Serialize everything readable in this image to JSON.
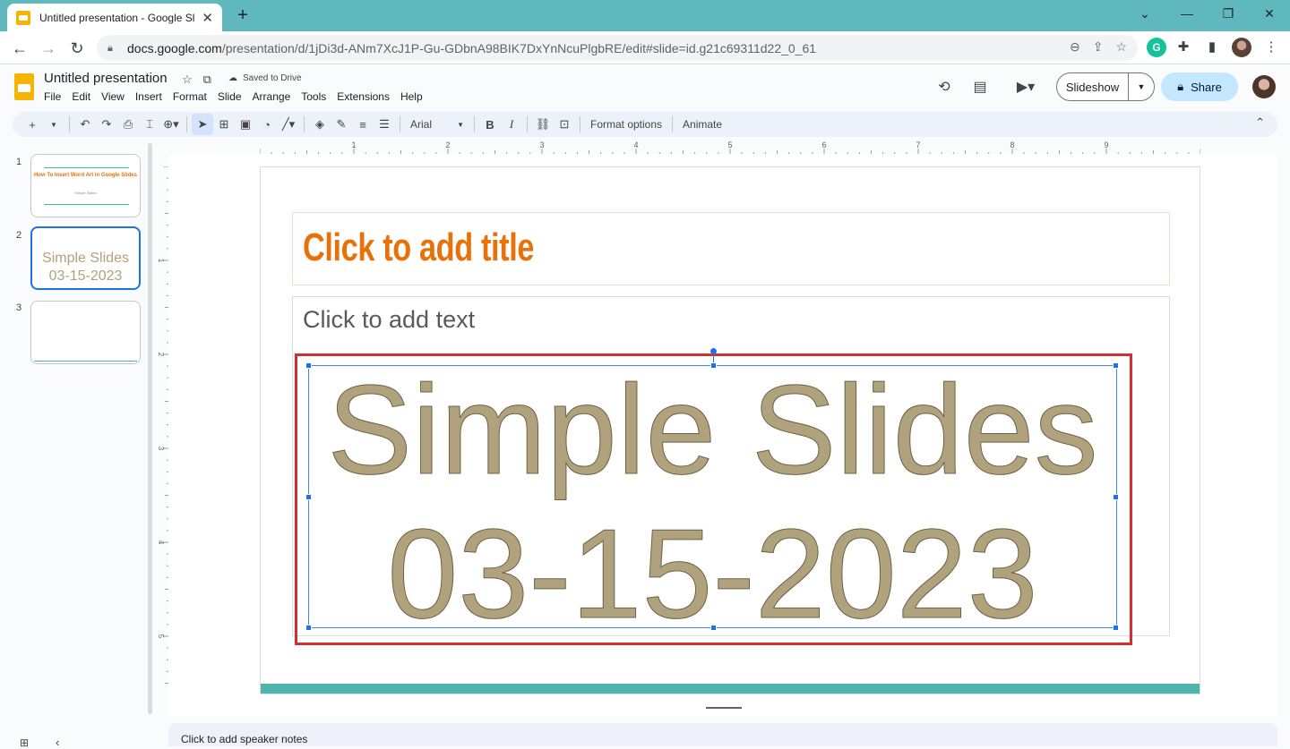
{
  "browser": {
    "tab_title": "Untitled presentation - Google Sl",
    "tab_close": "✕",
    "new_tab": "+",
    "url_host": "docs.google.com",
    "url_rest": "/presentation/d/1jDi3d-ANm7XcJ1P-Gu-GDbnA98BIK7DxYnNcuPlgbRE/edit#slide=id.g21c69311d22_0_61",
    "grammarly": "G"
  },
  "doc": {
    "title": "Untitled presentation",
    "saved_status": "Saved to Drive",
    "menu": [
      "File",
      "Edit",
      "View",
      "Insert",
      "Format",
      "Slide",
      "Arrange",
      "Tools",
      "Extensions",
      "Help"
    ],
    "slideshow_label": "Slideshow",
    "share_label": "Share"
  },
  "toolbar": {
    "font": "Arial",
    "bold": "B",
    "italic": "I",
    "format_options": "Format options",
    "animate": "Animate"
  },
  "filmstrip": {
    "slides": [
      {
        "number": "1",
        "title": "How To Insert Word Art in Google Slides",
        "subtitle": "Simple Slides"
      },
      {
        "number": "2",
        "line1": "Simple Slides",
        "line2": "03-15-2023"
      },
      {
        "number": "3"
      }
    ]
  },
  "rulers": {
    "h_labels": [
      "1",
      "2",
      "3",
      "4",
      "5",
      "6",
      "7",
      "8",
      "9"
    ],
    "v_labels": [
      "1",
      "2",
      "3",
      "4",
      "5"
    ]
  },
  "slide": {
    "title_placeholder": "Click to add title",
    "body_placeholder": "Click to add text",
    "wordart_line1": "Simple Slides",
    "wordart_line2": "03-15-2023"
  },
  "notes": {
    "placeholder": "Click to add speaker notes"
  },
  "colors": {
    "title_orange": "#e8710a",
    "wordart_fill": "#b0a27c",
    "accent_teal": "#4db6ac",
    "selection_blue": "#1a73e8",
    "highlight_red": "#d32f2f"
  }
}
